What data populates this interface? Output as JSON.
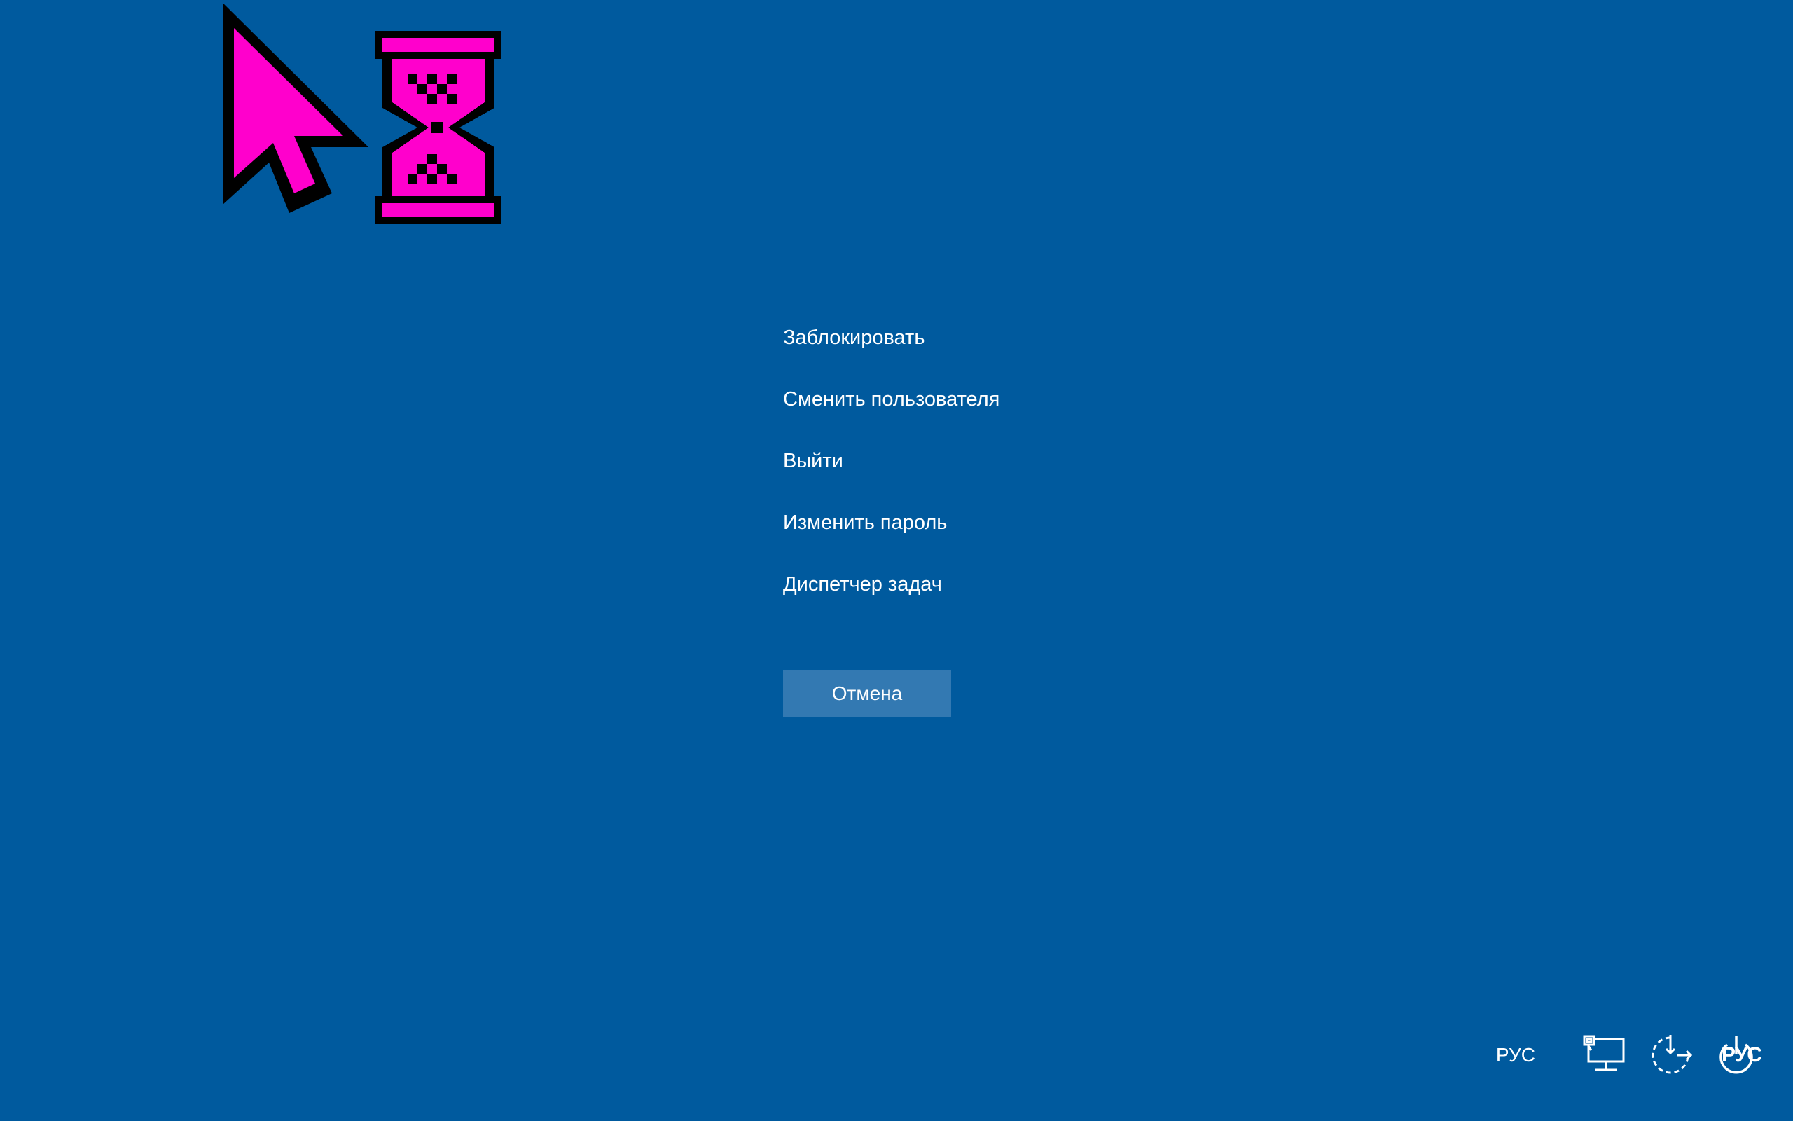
{
  "menu": {
    "items": [
      {
        "label": "Заблокировать"
      },
      {
        "label": "Сменить пользователя"
      },
      {
        "label": "Выйти"
      },
      {
        "label": "Изменить пароль"
      },
      {
        "label": "Диспетчер задач"
      }
    ],
    "cancel_label": "Отмена"
  },
  "tray": {
    "language": "РУС",
    "power_overlay": "РУС",
    "icons": [
      "network-icon",
      "accessibility-icon",
      "power-icon"
    ]
  },
  "colors": {
    "background": "#005a9e",
    "button": "#3379b2",
    "cursor": "#ff00cc"
  }
}
